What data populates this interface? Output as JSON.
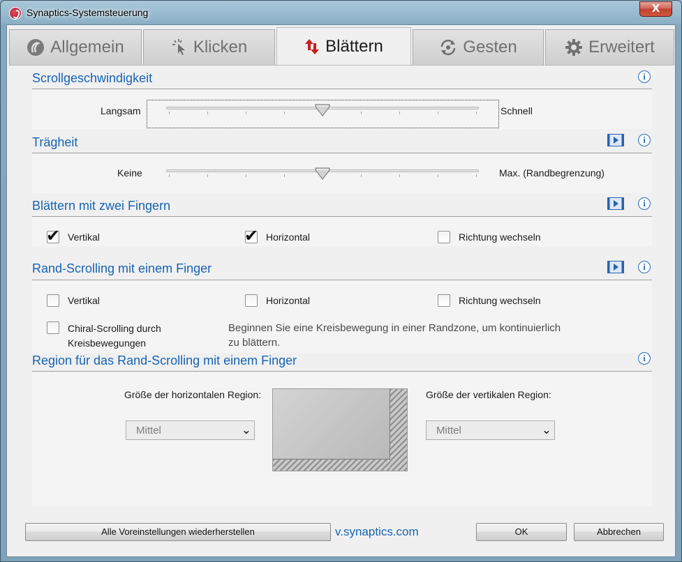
{
  "window": {
    "title": "Synaptics-Systemsteuerung",
    "close_glyph": "X"
  },
  "tabs": [
    {
      "label": "Allgemein",
      "icon": "synaptics-logo-icon",
      "active": false
    },
    {
      "label": "Klicken",
      "icon": "click-cursor-icon",
      "active": false
    },
    {
      "label": "Blättern",
      "icon": "scroll-arrows-icon",
      "active": true
    },
    {
      "label": "Gesten",
      "icon": "gesture-rotate-icon",
      "active": false
    },
    {
      "label": "Erweitert",
      "icon": "gear-icon",
      "active": false
    }
  ],
  "scroll_speed": {
    "title": "Scrollgeschwindigkeit",
    "min_label": "Langsam",
    "max_label": "Schnell",
    "value_fraction": 0.5
  },
  "inertia": {
    "title": "Trägheit",
    "min_label": "Keine",
    "max_label": "Max. (Randbegrenzung)",
    "value_fraction": 0.5
  },
  "two_finger": {
    "title": "Blättern mit zwei Fingern",
    "options": [
      {
        "label": "Vertikal",
        "checked": true
      },
      {
        "label": "Horizontal",
        "checked": true
      },
      {
        "label": "Richtung wechseln",
        "checked": false
      }
    ]
  },
  "edge_scroll": {
    "title": "Rand-Scrolling mit einem Finger",
    "options": [
      {
        "label": "Vertikal",
        "checked": false
      },
      {
        "label": "Horizontal",
        "checked": false
      },
      {
        "label": "Richtung wechseln",
        "checked": false
      }
    ],
    "chiral_label_line1": "Chiral-Scrolling durch",
    "chiral_label_line2": "Kreisbewegungen",
    "chiral_checked": false,
    "chiral_description_line1": "Beginnen Sie eine Kreisbewegung in einer Randzone, um kontinuierlich",
    "chiral_description_line2": "zu blättern."
  },
  "edge_region": {
    "title": "Region für das Rand-Scrolling mit einem Finger",
    "horizontal_label": "Größe der horizontalen Region:",
    "horizontal_value": "Mittel",
    "vertical_label": "Größe der vertikalen Region:",
    "vertical_value": "Mittel"
  },
  "footer": {
    "restore_label": "Alle Voreinstellungen wiederherstellen",
    "website": "v.synaptics.com",
    "ok_label": "OK",
    "cancel_label": "Abbrechen"
  },
  "colors": {
    "accent": "#1664b4",
    "info_icon": "#2f6fb9",
    "close_button": "#c2402f"
  }
}
